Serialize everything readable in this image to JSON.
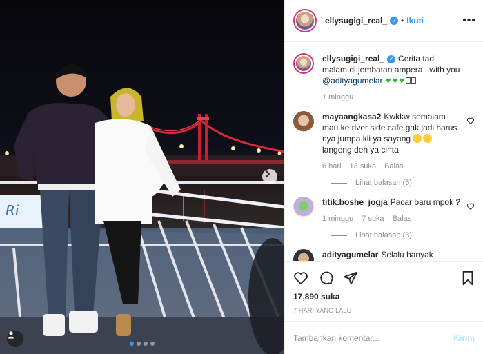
{
  "header": {
    "username": "ellysugigi_real_",
    "follow_label": "Ikuti",
    "dot": "•"
  },
  "caption": {
    "username": "ellysugigi_real_",
    "text": "Cerita tadi malam di jembatan ampera ..with you ",
    "mention": "@adityagumelar",
    "time": "1 minggu"
  },
  "comments": [
    {
      "username": "mayaangkasa2",
      "text": "Kwkkw semalam mau ke river side cafe gak jadi harus nya jumpa kli ya sayang",
      "text2": " langeng deh ya cinta",
      "time": "6 hari",
      "likes": "13 suka",
      "reply": "Balas",
      "view_replies": "Lihat balasan (5)"
    },
    {
      "username": "titik.boshe_jogja",
      "text": "Pacar baru mpok ?",
      "time": "1 minggu",
      "likes": "7 suka",
      "reply": "Balas",
      "view_replies": "Lihat balasan (3)"
    },
    {
      "username": "adityagumelar",
      "text": "Selalu banyak"
    }
  ],
  "actions": {
    "likes": "17,890 suka",
    "time": "7 HARI YANG LALU"
  },
  "add_comment": {
    "placeholder": "Tambahkan komentar...",
    "send_label": "Kirim"
  },
  "photo": {
    "sign_text": "Ri"
  },
  "colors": {
    "accent": "#3897f0",
    "verified": "#3897f0",
    "send_disabled": "#b2dffc",
    "muted": "#8e8e8e",
    "bridge_red": "#d8283a"
  }
}
